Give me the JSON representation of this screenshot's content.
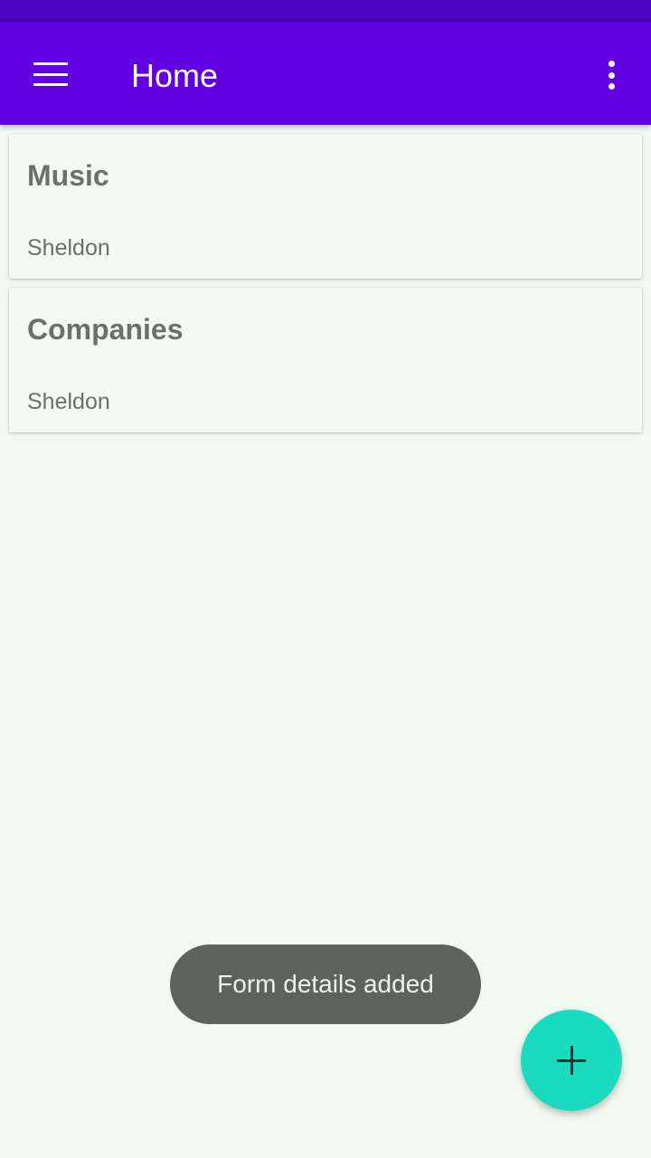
{
  "app_bar": {
    "title": "Home",
    "menu_icon": "hamburger-menu-icon",
    "overflow_icon": "more-vert-icon",
    "color": "#6100e0"
  },
  "cards": [
    {
      "title": "Music",
      "subtitle": "Sheldon"
    },
    {
      "title": "Companies",
      "subtitle": "Sheldon"
    }
  ],
  "toast": {
    "text": "Form details added"
  },
  "fab": {
    "icon": "plus-icon",
    "color": "#19dbbf"
  },
  "colors": {
    "background": "#f1f9f0",
    "status_bar": "#4d03c4",
    "card_text": "#6c6f6a",
    "toast_bg": "#5b6459"
  }
}
